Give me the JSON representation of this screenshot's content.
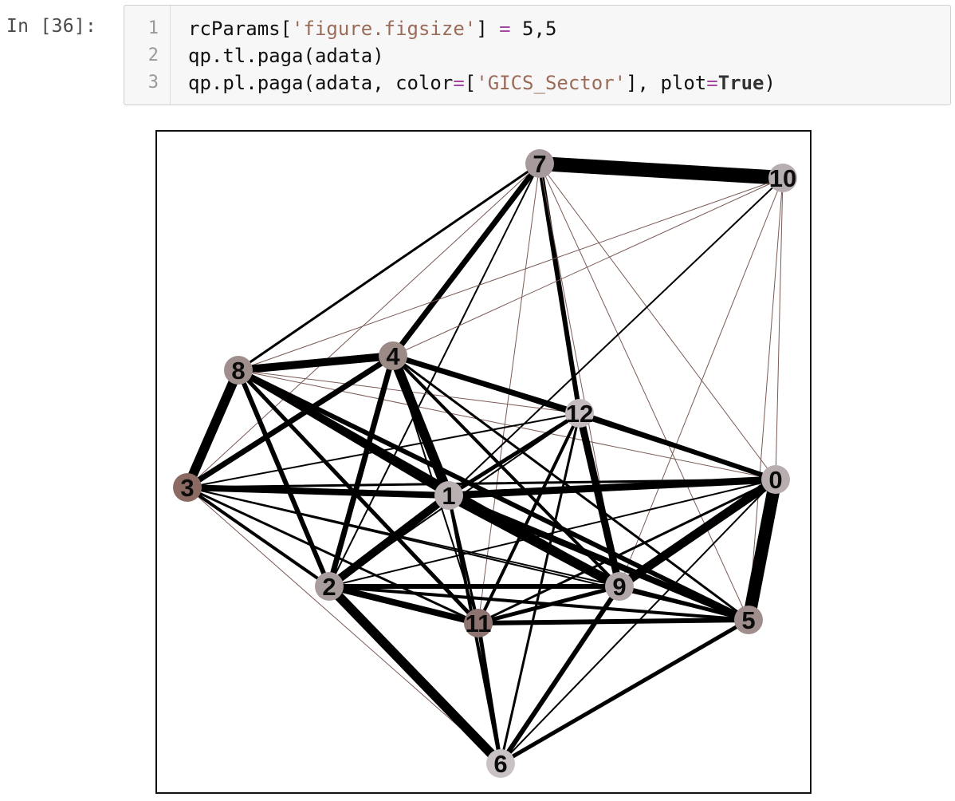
{
  "cell": {
    "prompt": "In [36]:",
    "line_numbers": [
      "1",
      "2",
      "3"
    ],
    "lines": [
      [
        {
          "t": "rcParams[",
          "c": "plain"
        },
        {
          "t": "'figure.figsize'",
          "c": "str"
        },
        {
          "t": "] ",
          "c": "plain"
        },
        {
          "t": "=",
          "c": "op"
        },
        {
          "t": " 5,5",
          "c": "plain"
        }
      ],
      [
        {
          "t": "qp.tl.paga(adata)",
          "c": "plain"
        }
      ],
      [
        {
          "t": "qp.pl.paga(adata, color",
          "c": "plain"
        },
        {
          "t": "=",
          "c": "op"
        },
        {
          "t": "[",
          "c": "plain"
        },
        {
          "t": "'GICS_Sector'",
          "c": "str"
        },
        {
          "t": "], plot",
          "c": "plain"
        },
        {
          "t": "=",
          "c": "op"
        },
        {
          "t": "True",
          "c": "kwtrue"
        },
        {
          "t": ")",
          "c": "plain"
        }
      ]
    ]
  },
  "graph": {
    "edge_color": "#000000",
    "thin_edge_color": "#7a5a55",
    "nodes": [
      {
        "id": "0",
        "fill": "#b8aeb0"
      },
      {
        "id": "1",
        "fill": "#b9b0b2"
      },
      {
        "id": "2",
        "fill": "#a89c9c"
      },
      {
        "id": "3",
        "fill": "#8a6a62"
      },
      {
        "id": "4",
        "fill": "#9c8a86"
      },
      {
        "id": "5",
        "fill": "#a08e8c"
      },
      {
        "id": "6",
        "fill": "#c9c2c4"
      },
      {
        "id": "7",
        "fill": "#a79a9c"
      },
      {
        "id": "8",
        "fill": "#9e8e8c"
      },
      {
        "id": "9",
        "fill": "#b0a6a8"
      },
      {
        "id": "10",
        "fill": "#b6aeb0"
      },
      {
        "id": "11",
        "fill": "#8e7470"
      },
      {
        "id": "12",
        "fill": "#c4bcbe"
      }
    ],
    "edges": [
      [
        "7",
        "10",
        18
      ],
      [
        "7",
        "8",
        3
      ],
      [
        "7",
        "4",
        7
      ],
      [
        "7",
        "12",
        6
      ],
      [
        "7",
        "2",
        2
      ],
      [
        "7",
        "9",
        1
      ],
      [
        "7",
        "5",
        1
      ],
      [
        "7",
        "11",
        1
      ],
      [
        "7",
        "3",
        1
      ],
      [
        "7",
        "0",
        1
      ],
      [
        "10",
        "8",
        1
      ],
      [
        "10",
        "4",
        1
      ],
      [
        "10",
        "1",
        2
      ],
      [
        "10",
        "0",
        1
      ],
      [
        "10",
        "5",
        1
      ],
      [
        "10",
        "9",
        1
      ],
      [
        "8",
        "4",
        10
      ],
      [
        "8",
        "3",
        12
      ],
      [
        "8",
        "2",
        6
      ],
      [
        "8",
        "1",
        7
      ],
      [
        "8",
        "9",
        8
      ],
      [
        "8",
        "5",
        6
      ],
      [
        "8",
        "12",
        1
      ],
      [
        "8",
        "0",
        1
      ],
      [
        "8",
        "11",
        5
      ],
      [
        "4",
        "3",
        7
      ],
      [
        "4",
        "1",
        12
      ],
      [
        "4",
        "2",
        7
      ],
      [
        "4",
        "12",
        7
      ],
      [
        "4",
        "9",
        4
      ],
      [
        "4",
        "5",
        3
      ],
      [
        "4",
        "0",
        3
      ],
      [
        "4",
        "11",
        2
      ],
      [
        "12",
        "0",
        6
      ],
      [
        "12",
        "9",
        9
      ],
      [
        "12",
        "1",
        5
      ],
      [
        "12",
        "11",
        4
      ],
      [
        "12",
        "3",
        2
      ],
      [
        "12",
        "2",
        2
      ],
      [
        "12",
        "6",
        3
      ],
      [
        "3",
        "1",
        8
      ],
      [
        "3",
        "0",
        3
      ],
      [
        "3",
        "2",
        4
      ],
      [
        "3",
        "11",
        3
      ],
      [
        "3",
        "9",
        2
      ],
      [
        "3",
        "5",
        2
      ],
      [
        "3",
        "6",
        1
      ],
      [
        "1",
        "0",
        9
      ],
      [
        "1",
        "9",
        12
      ],
      [
        "1",
        "2",
        10
      ],
      [
        "1",
        "5",
        8
      ],
      [
        "1",
        "11",
        3
      ],
      [
        "1",
        "6",
        4
      ],
      [
        "0",
        "9",
        11
      ],
      [
        "0",
        "5",
        16
      ],
      [
        "0",
        "11",
        3
      ],
      [
        "0",
        "2",
        2
      ],
      [
        "0",
        "6",
        2
      ],
      [
        "2",
        "9",
        6
      ],
      [
        "2",
        "11",
        8
      ],
      [
        "2",
        "6",
        12
      ],
      [
        "2",
        "5",
        4
      ],
      [
        "9",
        "11",
        5
      ],
      [
        "9",
        "5",
        5
      ],
      [
        "9",
        "6",
        6
      ],
      [
        "11",
        "5",
        6
      ],
      [
        "11",
        "6",
        5
      ],
      [
        "5",
        "6",
        5
      ]
    ]
  }
}
